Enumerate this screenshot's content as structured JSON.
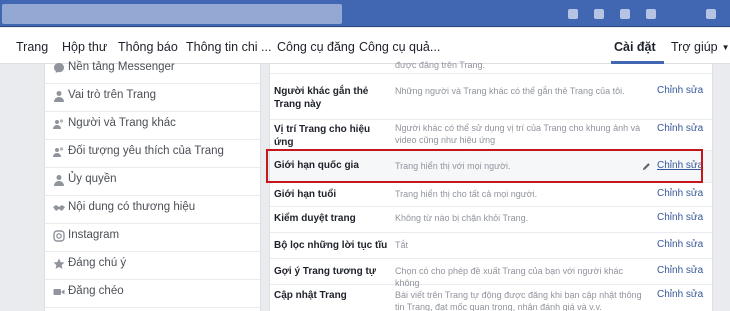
{
  "nav": {
    "items": [
      {
        "label": "Trang"
      },
      {
        "label": "Hộp thư"
      },
      {
        "label": "Thông báo"
      },
      {
        "label": "Thông tin chi ..."
      },
      {
        "label": "Công cụ đăng"
      },
      {
        "label": "Công cụ quả..."
      },
      {
        "label": "Cài đặt"
      },
      {
        "label": "Trợ giúp"
      }
    ]
  },
  "sidebar": {
    "items": [
      {
        "label": "Nền tảng Messenger",
        "icon": "messenger-icon"
      },
      {
        "label": "Vai trò trên Trang",
        "icon": "person-icon"
      },
      {
        "label": "Người và Trang khác",
        "icon": "people-icon"
      },
      {
        "label": "Đối tượng yêu thích của Trang",
        "icon": "people-icon"
      },
      {
        "label": "Ủy quyền",
        "icon": "person-icon"
      },
      {
        "label": "Nội dung có thương hiệu",
        "icon": "handshake-icon"
      },
      {
        "label": "Instagram",
        "icon": "instagram-icon"
      },
      {
        "label": "Đáng chú ý",
        "icon": "star-icon"
      },
      {
        "label": "Đăng chéo",
        "icon": "video-icon"
      }
    ]
  },
  "settings": {
    "top_desc": "được đăng trên Trang.",
    "rows": [
      {
        "title": "Người khác gắn thẻ Trang này",
        "desc": "Những người và Trang khác có thể gắn thẻ Trang của tôi.",
        "edit": "Chỉnh sửa"
      },
      {
        "title": "Vị trí Trang cho hiệu ứng",
        "desc": "Người khác có thể sử dụng vị trí của Trang cho khung ảnh và video cũng như hiệu ứng",
        "edit": "Chỉnh sửa"
      },
      {
        "title": "Giới hạn quốc gia",
        "desc": "Trang hiển thị với mọi người.",
        "edit": "Chỉnh sửa"
      },
      {
        "title": "Giới hạn tuổi",
        "desc": "Trang hiển thị cho tất cả mọi người.",
        "edit": "Chỉnh sửa"
      },
      {
        "title": "Kiểm duyệt trang",
        "desc": "Không từ nào bị chặn khỏi Trang.",
        "edit": "Chỉnh sửa"
      },
      {
        "title": "Bộ lọc những lời tục tĩu",
        "desc": "Tắt",
        "edit": "Chỉnh sửa"
      },
      {
        "title": "Gợi ý Trang tương tự",
        "desc": "Chọn có cho phép đề xuất Trang của bạn với người khác không",
        "edit": "Chỉnh sửa"
      },
      {
        "title": "Cập nhật Trang",
        "desc": "Bài viết trên Trang tự động được đăng khi bạn cập nhật thông tin Trang, đạt mốc quan trọng, nhận đánh giá và v.v.",
        "edit": "Chỉnh sửa"
      }
    ]
  },
  "colors": {
    "facebook_blue": "#4267b2",
    "link": "#365899",
    "highlight_border": "#c4161c"
  }
}
